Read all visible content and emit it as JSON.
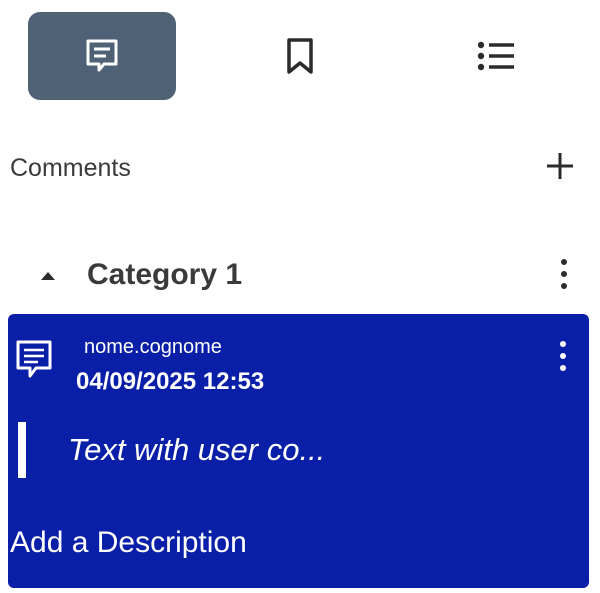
{
  "tabs": [
    {
      "icon": "comment-icon",
      "active": true
    },
    {
      "icon": "bookmark-icon",
      "active": false
    },
    {
      "icon": "list-icon",
      "active": false
    }
  ],
  "section": {
    "title": "Comments",
    "add_icon": "plus-icon"
  },
  "category": {
    "title": "Category 1",
    "collapse_icon": "caret-up-icon",
    "menu_icon": "kebab-menu-icon"
  },
  "comment": {
    "author": "nome.cognome",
    "date": "04/09/2025 12:53",
    "text": "Text with user co...",
    "add_description": "Add a Description",
    "icon": "comment-icon",
    "menu_icon": "kebab-menu-icon"
  },
  "colors": {
    "active_tab": "#4f6275",
    "card_background": "#0a1fa8",
    "text_dark": "#3a3a3a",
    "white": "#ffffff"
  }
}
